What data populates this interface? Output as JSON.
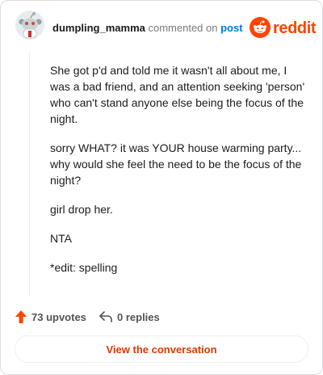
{
  "header": {
    "username": "dumpling_mamma",
    "action_text": "commented on",
    "post_link": "post",
    "logo_text": "reddit",
    "brand_color": "#ff4500"
  },
  "comment": {
    "paragraphs": [
      "She got p'd and told me it wasn't all about me, I was a bad friend, and an attention seeking 'person' who can't stand anyone else being the focus of the night.",
      "sorry WHAT? it was YOUR house warming party... why would she feel the need to be the focus of the night?",
      "girl drop her.",
      "NTA",
      "*edit: spelling"
    ]
  },
  "actions": {
    "upvotes_label": "73 upvotes",
    "upvote_icon": "upvote-arrow-icon",
    "upvote_color": "#ff4500",
    "replies_label": "0 replies",
    "reply_icon": "reply-arrow-icon"
  },
  "footer": {
    "view_button_label": "View the conversation",
    "button_text_color": "#d93a00"
  }
}
